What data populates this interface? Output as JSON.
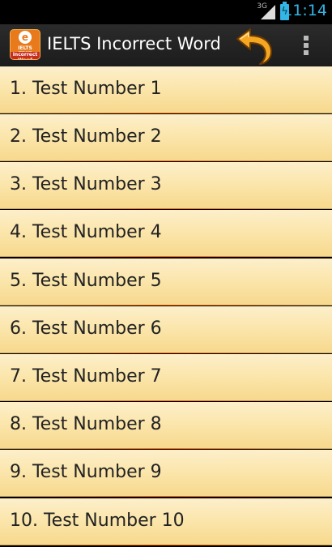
{
  "status_bar": {
    "network": "3G",
    "time": "11:14",
    "battery_icon": "battery-charging-icon",
    "signal_icon": "signal-icon"
  },
  "action_bar": {
    "title": "IELTS Incorrect Word",
    "app_icon": {
      "letter": "e",
      "line1": "IELTS TEST",
      "line2": "Incorrect Word"
    },
    "back_icon": "back-arrow-icon",
    "overflow_icon": "overflow-menu-icon"
  },
  "list": {
    "items": [
      {
        "label": "1. Test Number 1"
      },
      {
        "label": "2. Test Number 2"
      },
      {
        "label": "3. Test Number 3"
      },
      {
        "label": "4. Test Number 4"
      },
      {
        "label": "5. Test Number 5"
      },
      {
        "label": "6. Test Number 6"
      },
      {
        "label": "7. Test Number 7"
      },
      {
        "label": "8. Test Number 8"
      },
      {
        "label": "9. Test Number 9"
      },
      {
        "label": "10. Test Number 10"
      }
    ]
  },
  "colors": {
    "status_accent": "#33b5e5",
    "item_gradient_top": "#fcefcb",
    "item_gradient_bottom": "#f7d98e",
    "divider_accent": "#ff6a00",
    "back_arrow_fill": "#f5a623"
  }
}
